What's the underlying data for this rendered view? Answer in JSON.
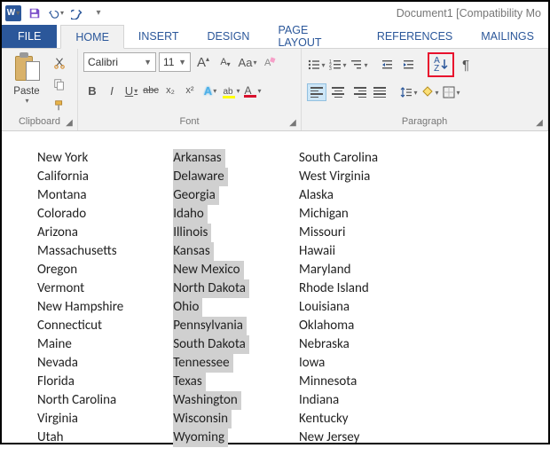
{
  "titlebar": {
    "doc_title": "Document1 [Compatibility Mo",
    "word_glyph": "W"
  },
  "tabs": {
    "file": "FILE",
    "home": "HOME",
    "insert": "INSERT",
    "design": "DESIGN",
    "pagelayout": "PAGE LAYOUT",
    "references": "REFERENCES",
    "mailings": "MAILINGS"
  },
  "ribbon": {
    "clipboard": {
      "label": "Clipboard",
      "paste": "Paste"
    },
    "font": {
      "label": "Font",
      "name": "Calibri",
      "size": "11",
      "grow": "A",
      "shrink": "A",
      "changecase": "Aa",
      "bold": "B",
      "italic": "I",
      "underline": "U",
      "strike": "abc",
      "sub": "x₂",
      "sup": "x²",
      "texteffects": "A",
      "highlight": "ab",
      "fontcolor": "A"
    },
    "paragraph": {
      "label": "Paragraph",
      "sort_a": "A",
      "sort_z": "Z",
      "pilcrow": "¶"
    }
  },
  "columns": {
    "left": [
      "New York",
      "California",
      "Montana",
      "Colorado",
      "Arizona",
      "Massachusetts",
      "Oregon",
      "Vermont",
      "New Hampshire",
      "Connecticut",
      "Maine",
      "Nevada",
      "Florida",
      "North Carolina",
      "Virginia",
      "Utah"
    ],
    "middle": [
      "Arkansas",
      "Delaware",
      "Georgia",
      "Idaho",
      "Illinois",
      "Kansas",
      "New Mexico",
      "North Dakota",
      "Ohio",
      "Pennsylvania",
      "South Dakota",
      "Tennessee",
      "Texas",
      "Washington",
      "Wisconsin",
      "Wyoming"
    ],
    "right": [
      "South Carolina",
      "West Virginia",
      "Alaska",
      "Michigan",
      "Missouri",
      "Hawaii",
      "Maryland",
      "Rhode Island",
      "Louisiana",
      "Oklahoma",
      "Nebraska",
      "Iowa",
      "Minnesota",
      "Indiana",
      "Kentucky",
      "New Jersey"
    ]
  }
}
